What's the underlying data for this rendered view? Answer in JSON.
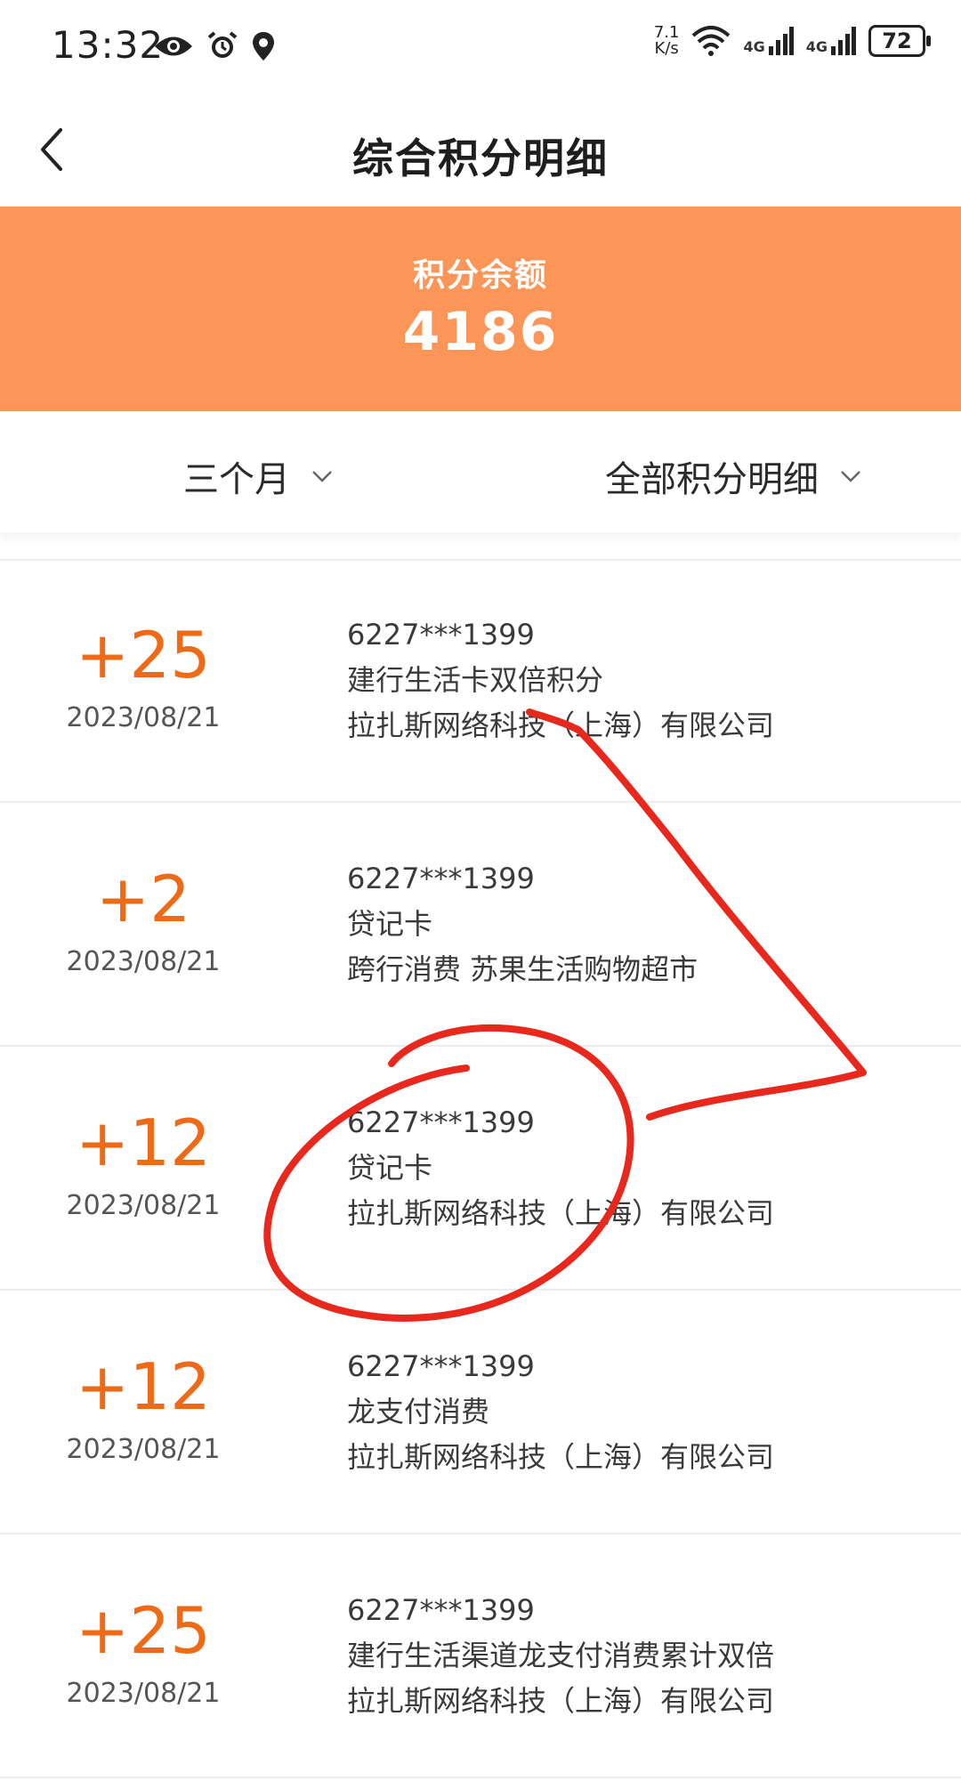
{
  "status_bar": {
    "time": "13:32",
    "net_speed_value": "7.1",
    "net_speed_unit": "K/s",
    "network_label_1": "4G",
    "network_label_2": "4G",
    "battery": "72"
  },
  "header": {
    "back_icon": "chevron-left-icon",
    "title": "综合积分明细"
  },
  "balance": {
    "label": "积分余额",
    "value": "4186",
    "background_color": "#fc9658"
  },
  "filters": {
    "period": "三个月",
    "type": "全部积分明细"
  },
  "records": [
    {
      "points": "+25",
      "date": "2023/08/21",
      "card": "6227***1399",
      "category": "建行生活卡双倍积分",
      "merchant": "拉扎斯网络科技（上海）有限公司"
    },
    {
      "points": "+2",
      "date": "2023/08/21",
      "card": "6227***1399",
      "category": "贷记卡",
      "merchant": "跨行消费 苏果生活购物超市"
    },
    {
      "points": "+12",
      "date": "2023/08/21",
      "card": "6227***1399",
      "category": "贷记卡",
      "merchant": "拉扎斯网络科技（上海）有限公司"
    },
    {
      "points": "+12",
      "date": "2023/08/21",
      "card": "6227***1399",
      "category": "龙支付消费",
      "merchant": "拉扎斯网络科技（上海）有限公司"
    },
    {
      "points": "+25",
      "date": "2023/08/21",
      "card": "6227***1399",
      "category": "建行生活渠道龙支付消费累计双倍",
      "merchant": "拉扎斯网络科技（上海）有限公司"
    }
  ],
  "colors": {
    "points": "#ee6a17",
    "annotation": "#e8281c"
  }
}
